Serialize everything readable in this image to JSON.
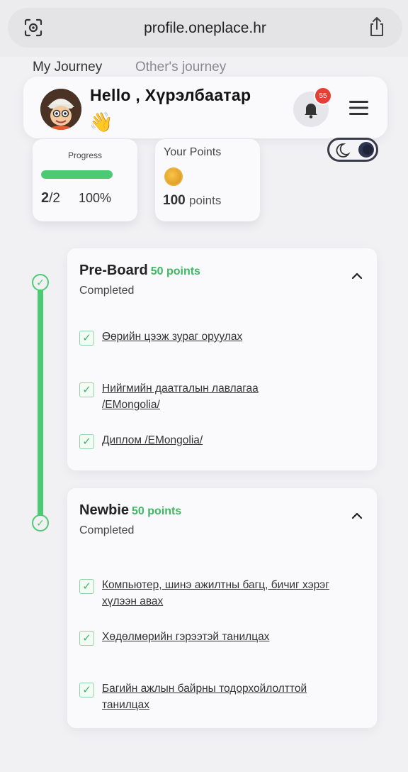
{
  "browser": {
    "url": "profile.oneplace.hr"
  },
  "tabs": [
    {
      "label": "My Journey"
    },
    {
      "label": "Other's journey"
    }
  ],
  "greeting": {
    "text": "Hello , Хүрэлбаатар",
    "emoji": "👋",
    "notification_count": "55"
  },
  "stats": {
    "progress": {
      "label": "Progress",
      "done": "2",
      "total": "/2",
      "percent": "100%",
      "fill_fraction": 1.0
    },
    "points": {
      "label": "Your Points",
      "value": "100",
      "unit": "points"
    }
  },
  "sections": [
    {
      "title": "Pre-Board",
      "points": "50 points",
      "status": "Completed",
      "tasks": [
        "Өөрийн цээж зураг оруулах",
        "Нийгмийн даатгалын лавлагаа /EMongolia/",
        "Диплом /EMongolia/"
      ]
    },
    {
      "title": "Newbie",
      "points": "50 points",
      "status": "Completed",
      "tasks": [
        "Компьютер, шинэ ажилтны багц, бичиг хэрэг хүлээн авах",
        "Хөдөлмөрийн гэрээтэй танилцах",
        "Багийн ажлын байрны тодорхойлолттой танилцах"
      ]
    }
  ],
  "colors": {
    "accent_green": "#4cca73",
    "badge_red": "#e53e36"
  },
  "icons": [
    "lens-icon",
    "share-icon",
    "bell-icon",
    "menu-icon",
    "moon-icon",
    "chevron-up-icon",
    "check-icon",
    "coin-icon"
  ]
}
